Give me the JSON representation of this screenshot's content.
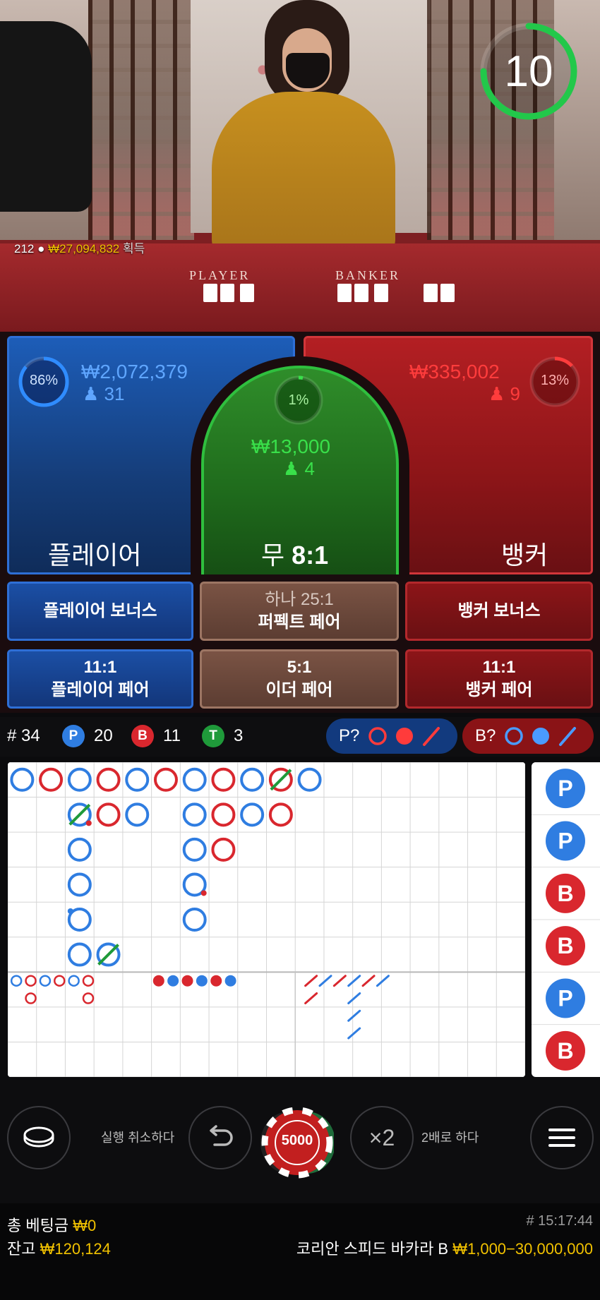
{
  "video": {
    "table_player_label": "PLAYER",
    "table_banker_label": "BANKER",
    "winners_count": "212",
    "winners_amount": "₩27,094,832",
    "winners_suffix": "획득",
    "countdown": "10"
  },
  "bets": {
    "player": {
      "label": "플레이어",
      "percent": "86%",
      "percent_value": 0.86,
      "amount": "₩2,072,379",
      "players": "31"
    },
    "tie": {
      "label_prefix": "무",
      "label_odds": "8:1",
      "percent": "1%",
      "percent_value": 0.01,
      "amount": "₩13,000",
      "players": "4"
    },
    "banker": {
      "label": "뱅커",
      "percent": "13%",
      "percent_value": 0.13,
      "amount": "₩335,002",
      "players": "9"
    }
  },
  "side_bets": {
    "player_bonus": "플레이어 보너스",
    "perfect_pair_odds": "하나 25:1",
    "perfect_pair": "퍼펙트 페어",
    "banker_bonus": "뱅커 보너스",
    "player_pair_odds": "11:1",
    "player_pair": "플레이어 페어",
    "either_pair_odds": "5:1",
    "either_pair": "이더 페어",
    "banker_pair_odds": "11:1",
    "banker_pair": "뱅커 페어"
  },
  "stats": {
    "rounds_label": "# 34",
    "p_badge": "P",
    "p_count": "20",
    "b_badge": "B",
    "b_count": "11",
    "t_badge": "T",
    "t_count": "3",
    "player_predict": "P?",
    "banker_predict": "B?"
  },
  "colors": {
    "player": "#2f7de1",
    "banker": "#d9272e",
    "tie": "#1f9a3a",
    "gold": "#f2c200"
  },
  "roadmap": {
    "big_road": [
      {
        "col": 0,
        "row": 0,
        "c": "P"
      },
      {
        "col": 1,
        "row": 0,
        "c": "B"
      },
      {
        "col": 2,
        "row": 0,
        "c": "P"
      },
      {
        "col": 3,
        "row": 0,
        "c": "B"
      },
      {
        "col": 4,
        "row": 0,
        "c": "P"
      },
      {
        "col": 5,
        "row": 0,
        "c": "B"
      },
      {
        "col": 6,
        "row": 0,
        "c": "P"
      },
      {
        "col": 7,
        "row": 0,
        "c": "B"
      },
      {
        "col": 8,
        "row": 0,
        "c": "P"
      },
      {
        "col": 9,
        "row": 0,
        "c": "B",
        "tie": true
      },
      {
        "col": 10,
        "row": 0,
        "c": "P"
      },
      {
        "col": 2,
        "row": 1,
        "c": "P",
        "tie": true,
        "bpair": true
      },
      {
        "col": 3,
        "row": 1,
        "c": "B"
      },
      {
        "col": 4,
        "row": 1,
        "c": "P"
      },
      {
        "col": 6,
        "row": 1,
        "c": "P"
      },
      {
        "col": 7,
        "row": 1,
        "c": "B"
      },
      {
        "col": 8,
        "row": 1,
        "c": "P"
      },
      {
        "col": 9,
        "row": 1,
        "c": "B"
      },
      {
        "col": 2,
        "row": 2,
        "c": "P"
      },
      {
        "col": 6,
        "row": 2,
        "c": "P"
      },
      {
        "col": 7,
        "row": 2,
        "c": "B"
      },
      {
        "col": 2,
        "row": 3,
        "c": "P"
      },
      {
        "col": 6,
        "row": 3,
        "c": "P",
        "bpair": true
      },
      {
        "col": 2,
        "row": 4,
        "c": "P",
        "ppair": true
      },
      {
        "col": 6,
        "row": 4,
        "c": "P"
      },
      {
        "col": 2,
        "row": 5,
        "c": "P"
      },
      {
        "col": 3,
        "row": 5,
        "c": "P",
        "tie": true
      }
    ],
    "big_eye": [
      {
        "col": 0,
        "row": 0,
        "c": "P"
      },
      {
        "col": 1,
        "row": 0,
        "c": "B"
      },
      {
        "col": 2,
        "row": 0,
        "c": "P"
      },
      {
        "col": 3,
        "row": 0,
        "c": "B"
      },
      {
        "col": 4,
        "row": 0,
        "c": "P"
      },
      {
        "col": 5,
        "row": 0,
        "c": "B"
      },
      {
        "col": 1,
        "row": 1,
        "c": "B"
      },
      {
        "col": 5,
        "row": 1,
        "c": "B"
      }
    ],
    "small_road": [
      {
        "col": 0,
        "row": 0,
        "c": "B"
      },
      {
        "col": 1,
        "row": 0,
        "c": "P"
      },
      {
        "col": 2,
        "row": 0,
        "c": "B"
      },
      {
        "col": 3,
        "row": 0,
        "c": "P"
      },
      {
        "col": 4,
        "row": 0,
        "c": "B"
      },
      {
        "col": 5,
        "row": 0,
        "c": "P"
      }
    ],
    "cockroach": [
      {
        "col": 0,
        "row": 0,
        "c": "B"
      },
      {
        "col": 1,
        "row": 0,
        "c": "P"
      },
      {
        "col": 2,
        "row": 0,
        "c": "B"
      },
      {
        "col": 3,
        "row": 0,
        "c": "P"
      },
      {
        "col": 4,
        "row": 0,
        "c": "B"
      },
      {
        "col": 5,
        "row": 0,
        "c": "P"
      },
      {
        "col": 0,
        "row": 1,
        "c": "B"
      },
      {
        "col": 3,
        "row": 1,
        "c": "P"
      },
      {
        "col": 3,
        "row": 2,
        "c": "P"
      },
      {
        "col": 3,
        "row": 3,
        "c": "P"
      }
    ],
    "bead_plate": [
      "P",
      "P",
      "B",
      "B",
      "P",
      "B"
    ]
  },
  "controls": {
    "undo_label": "실행 취소하다",
    "chip_value": "5000",
    "double_symbol": "×2",
    "double_label": "2배로 하다"
  },
  "footer": {
    "total_bet_label": "총 베팅금",
    "total_bet_value": "₩0",
    "balance_label": "잔고",
    "balance_value": "₩120,124",
    "game_id": "# 15:17:44",
    "table_name": "코리안 스피드 바카라 B",
    "limits": "₩1,000−30,000,000"
  }
}
